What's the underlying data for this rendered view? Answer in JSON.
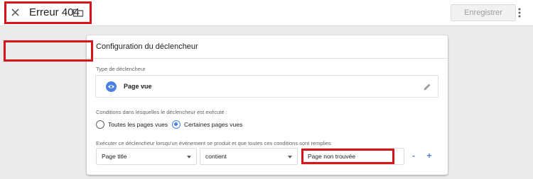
{
  "header": {
    "title": "Erreur 404",
    "save_label": "Enregistrer"
  },
  "card": {
    "title": "Configuration du déclencheur",
    "trigger_type": {
      "label": "Type de déclencheur",
      "name": "Page vue",
      "icon": "eye-icon"
    },
    "conditions": {
      "label": "Conditions dans lesquelles le déclencheur est exécuté :",
      "options": [
        {
          "label": "Toutes les pages vues",
          "selected": false
        },
        {
          "label": "Certaines pages vues",
          "selected": true
        }
      ]
    },
    "filter": {
      "label": "Exécuter ce déclencheur lorsqu'un événement se produit et que toutes ces conditions sont remplies",
      "variable": "Page title",
      "operator": "contient",
      "value": "Page non trouvée",
      "remove_label": "-",
      "add_label": "+"
    }
  },
  "colors": {
    "accent": "#4a7fe3",
    "annotation": "#d7141a"
  }
}
